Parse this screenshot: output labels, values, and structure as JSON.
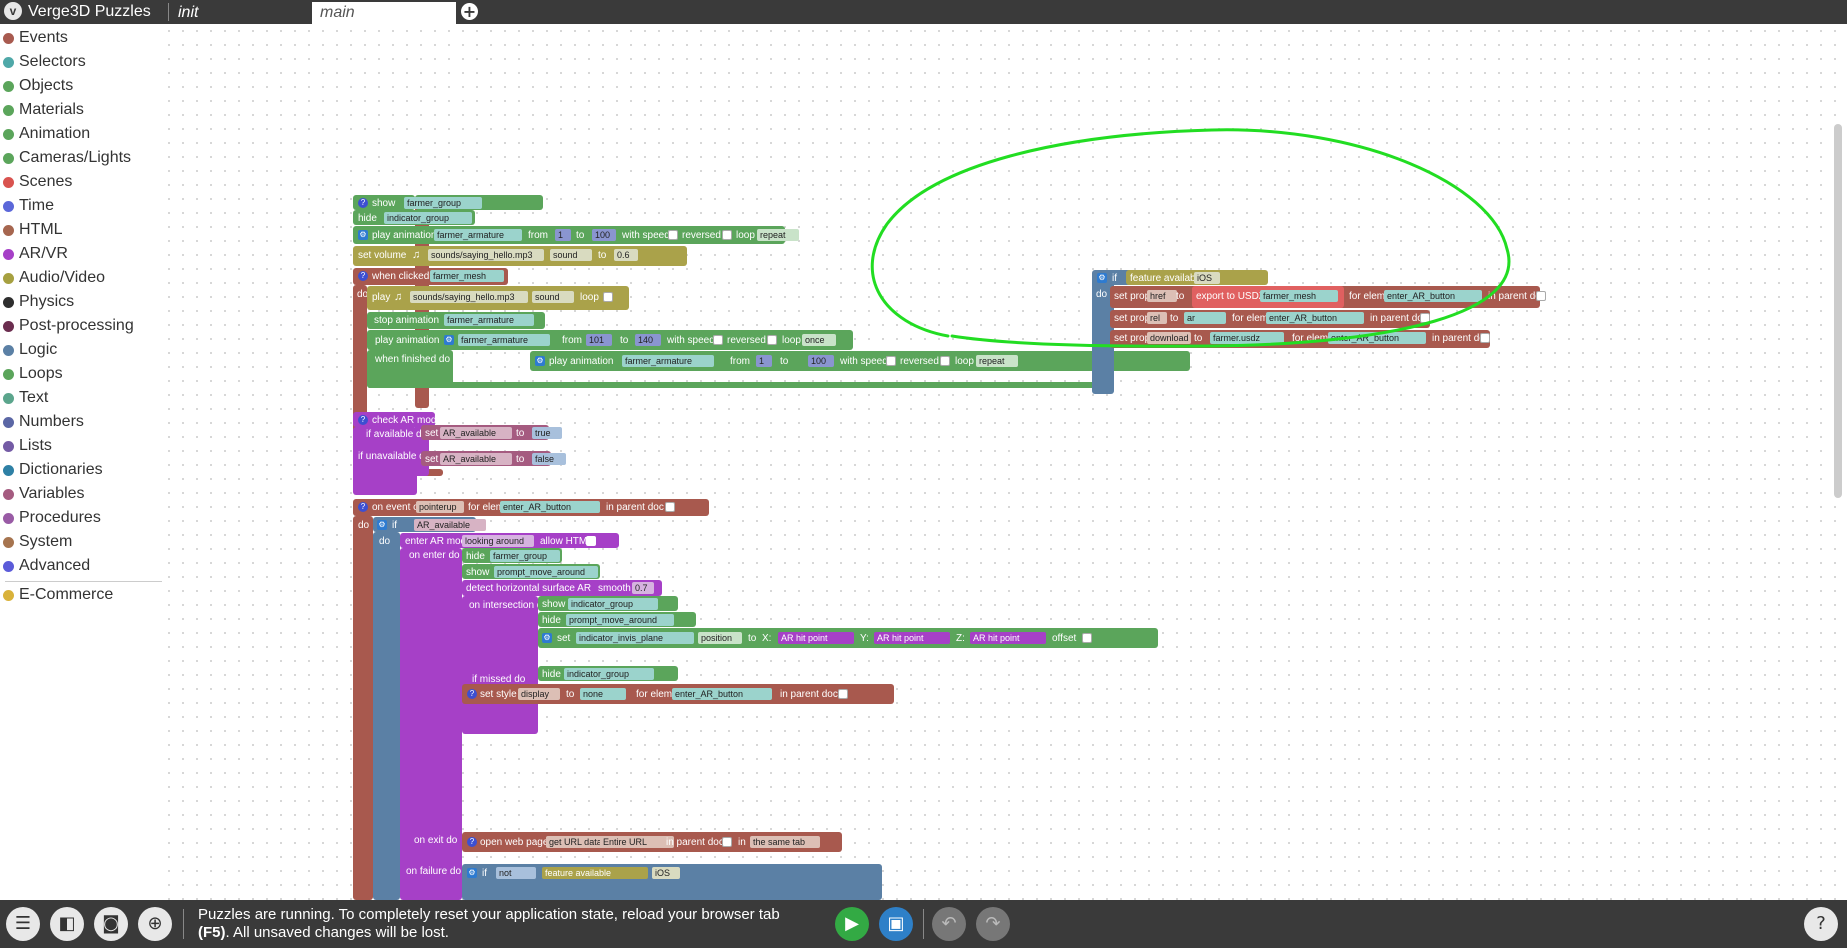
{
  "app": {
    "title": "Verge3D Puzzles",
    "logo_glyph": "v"
  },
  "tabs": [
    {
      "label": "init"
    },
    {
      "label": "main"
    }
  ],
  "add_tab_glyph": "+",
  "sidebar": {
    "categories": [
      {
        "label": "Events",
        "color": "#a85a4f"
      },
      {
        "label": "Selectors",
        "color": "#4fa8a8"
      },
      {
        "label": "Objects",
        "color": "#5ba55b"
      },
      {
        "label": "Materials",
        "color": "#5ba55b"
      },
      {
        "label": "Animation",
        "color": "#5ba55b"
      },
      {
        "label": "Cameras/Lights",
        "color": "#5ba55b"
      },
      {
        "label": "Scenes",
        "color": "#d9534f"
      },
      {
        "label": "Time",
        "color": "#5b67d9"
      },
      {
        "label": "HTML",
        "color": "#a6664f"
      },
      {
        "label": "AR/VR",
        "color": "#a640c7"
      },
      {
        "label": "Audio/Video",
        "color": "#a6a040"
      },
      {
        "label": "Physics",
        "color": "#2e2e2e"
      },
      {
        "label": "Post-processing",
        "color": "#6b2d4f"
      },
      {
        "label": "Logic",
        "color": "#5b80a5"
      },
      {
        "label": "Loops",
        "color": "#5ba55b"
      },
      {
        "label": "Text",
        "color": "#5ba58c"
      },
      {
        "label": "Numbers",
        "color": "#5b67a5"
      },
      {
        "label": "Lists",
        "color": "#745ba5"
      },
      {
        "label": "Dictionaries",
        "color": "#2e80a5"
      },
      {
        "label": "Variables",
        "color": "#a55b80"
      },
      {
        "label": "Procedures",
        "color": "#995ba5"
      },
      {
        "label": "System",
        "color": "#a6744f"
      },
      {
        "label": "Advanced",
        "color": "#5b5bd9"
      }
    ],
    "extra_categories": [
      {
        "label": "E-Commerce",
        "color": "#d9b23a"
      }
    ]
  },
  "blocks": {
    "g1": {
      "show": "show",
      "farmer_group": "farmer_group",
      "hide": "hide",
      "indicator_group": "indicator_group",
      "play_animation": "play animation",
      "farmer_armature": "farmer_armature",
      "from": "from",
      "v1": "1",
      "to": "to",
      "v100": "100",
      "with_speed": "with speed",
      "reversed": "reversed",
      "loop": "loop",
      "repeat": "repeat",
      "set_volume": "set volume",
      "sound_hello": "sounds/saying_hello.mp3",
      "sound": "sound",
      "v06": "0.6",
      "when_clicked": "when clicked",
      "farmer_mesh": "farmer_mesh",
      "do": "do",
      "play": "play",
      "stop_animation": "stop animation",
      "v101": "101",
      "v140": "140",
      "once": "once",
      "when_finished_do": "when finished do"
    },
    "g2": {
      "check_ar_mode": "check AR mode",
      "if_available_do": "if available do",
      "set": "set",
      "ar_available": "AR_available",
      "to": "to",
      "true_val": "true",
      "if_unavailable_do": "if unavailable do",
      "false_val": "false"
    },
    "g3": {
      "on_event_of": "on event of",
      "pointerup": "pointerup",
      "for_elem": "for elem",
      "enter_ar_button": "enter_AR_button",
      "in_parent_doc": "in parent doc",
      "do": "do",
      "if": "if",
      "ar_available": "AR_available",
      "enter_ar_mode": "enter AR mode",
      "looking_around": "looking around",
      "allow_html": "allow HTML",
      "on_enter_do": "on enter do",
      "hide": "hide",
      "farmer_group": "farmer_group",
      "show": "show",
      "prompt_move_around": "prompt_move_around",
      "detect_horizontal": "detect horizontal surface AR",
      "smooth": "smooth",
      "v07": "0.7",
      "on_intersection_do": "on intersection do",
      "indicator_group": "indicator_group",
      "set": "set",
      "indicator_invis_plane": "indicator_invis_plane",
      "position": "position",
      "to": "to",
      "x": "X:",
      "y": "Y:",
      "z": "Z:",
      "ar_hit_point": "AR hit point",
      "xs": "X",
      "ys": "Y",
      "zs": "Z",
      "offset": "offset",
      "if_missed_do": "if missed do",
      "set_style": "set style",
      "display": "display",
      "none": "none",
      "on_exit_do": "on exit do",
      "open_web_page": "open web page",
      "get_url_data": "get URL data",
      "entire_url": "Entire URL",
      "in": "in",
      "the_same_tab": "the same tab",
      "on_failure_do": "on failure do",
      "not": "not",
      "feature_available": "feature available",
      "ios": "iOS"
    },
    "g4": {
      "if": "if",
      "feature_available": "feature available",
      "ios": "iOS",
      "do": "do",
      "set_prop": "set prop",
      "href": "href",
      "to": "to",
      "export_to_usdz": "export to USDZ",
      "farmer_mesh": "farmer_mesh",
      "for_elem": "for elem",
      "enter_ar_button": "enter_AR_button",
      "in_parent_doc": "in parent doc",
      "rel": "rel",
      "ar": "ar",
      "download": "download",
      "farmer_usdz": "farmer.usdz"
    }
  },
  "bottombar": {
    "status_line1": "Puzzles are running. To completely reset your application state, reload your browser tab",
    "status_key": "(F5)",
    "status_line2": ". All unsaved changes will be lost.",
    "help": "?"
  },
  "colors": {
    "annotation": "#22dd22",
    "topbar": "#3a3a3a",
    "run": "#33aa44",
    "save": "#2e80c8"
  }
}
